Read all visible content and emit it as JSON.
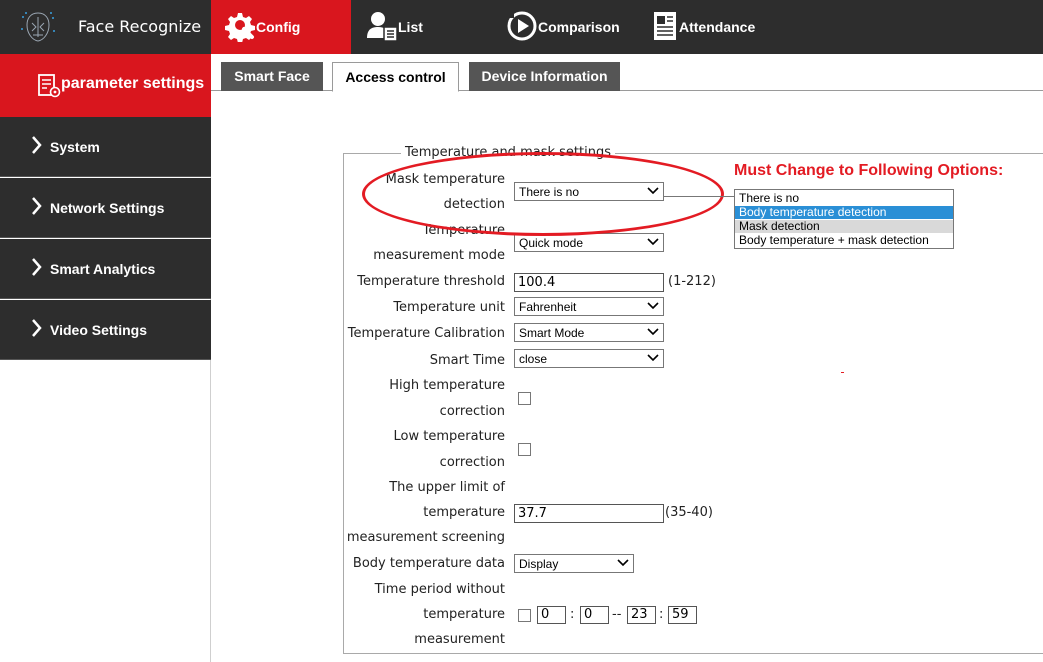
{
  "app": {
    "title": "Face Recognize"
  },
  "nav": {
    "config": "Config",
    "list": "List",
    "comparison": "Comparison",
    "attendance": "Attendance"
  },
  "sidebar": {
    "header": "parameter settings",
    "items": [
      {
        "label": "System"
      },
      {
        "label": "Network Settings"
      },
      {
        "label": "Smart Analytics"
      },
      {
        "label": "Video Settings"
      }
    ]
  },
  "tabs": [
    {
      "label": "Smart Face",
      "active": false
    },
    {
      "label": "Access control",
      "active": true
    },
    {
      "label": "Device Information",
      "active": false
    }
  ],
  "form": {
    "legend": "Temperature and mask settings",
    "mask_detection": {
      "label_line1": "Mask temperature",
      "label_line2": "detection",
      "value": "There is no"
    },
    "measurement_mode": {
      "label_line1": "Temperature",
      "label_line2": "measurement mode",
      "value": "Quick mode"
    },
    "threshold": {
      "label": "Temperature threshold",
      "value": "100.4",
      "range": "(1-212)"
    },
    "unit": {
      "label": "Temperature unit",
      "value": "Fahrenheit"
    },
    "calibration": {
      "label": "Temperature Calibration",
      "value": "Smart Mode"
    },
    "smart_time": {
      "label": "Smart Time",
      "value": "close"
    },
    "high_correction": {
      "label_line1": "High temperature",
      "label_line2": "correction",
      "checked": false
    },
    "low_correction": {
      "label_line1": "Low temperature",
      "label_line2": "correction",
      "checked": false
    },
    "upper_limit": {
      "label_line1": "The upper limit of",
      "label_line2": "temperature",
      "label_line3": "measurement screening",
      "value": "37.7",
      "range": "(35-40)"
    },
    "body_temp_data": {
      "label": "Body temperature data",
      "value": "Display"
    },
    "time_period": {
      "label_line1": "Time period without",
      "label_line2": "temperature",
      "label_line3": "measurement",
      "checked": false,
      "start_h": "0",
      "sep1": ":",
      "start_m": "0",
      "dash": "--",
      "end_h": "23",
      "sep2": ":",
      "end_m": "59"
    }
  },
  "annotation": {
    "title": "Must Change to Following Options:",
    "options": [
      "There is no",
      "Body temperature detection",
      "Mask detection",
      "Body temperature + mask detection"
    ],
    "color": "#e31b23"
  },
  "colors": {
    "accent": "#d9161e",
    "dark": "#2d2d2d",
    "highlight": "#2a8fd6"
  },
  "icons": {
    "logo": "face-scan-icon",
    "config": "gear-search-icon",
    "list": "user-list-icon",
    "comparison": "compare-play-icon",
    "attendance": "clipboard-icon",
    "sidebar_header": "settings-doc-icon",
    "chevron": "chevron-right-icon"
  }
}
